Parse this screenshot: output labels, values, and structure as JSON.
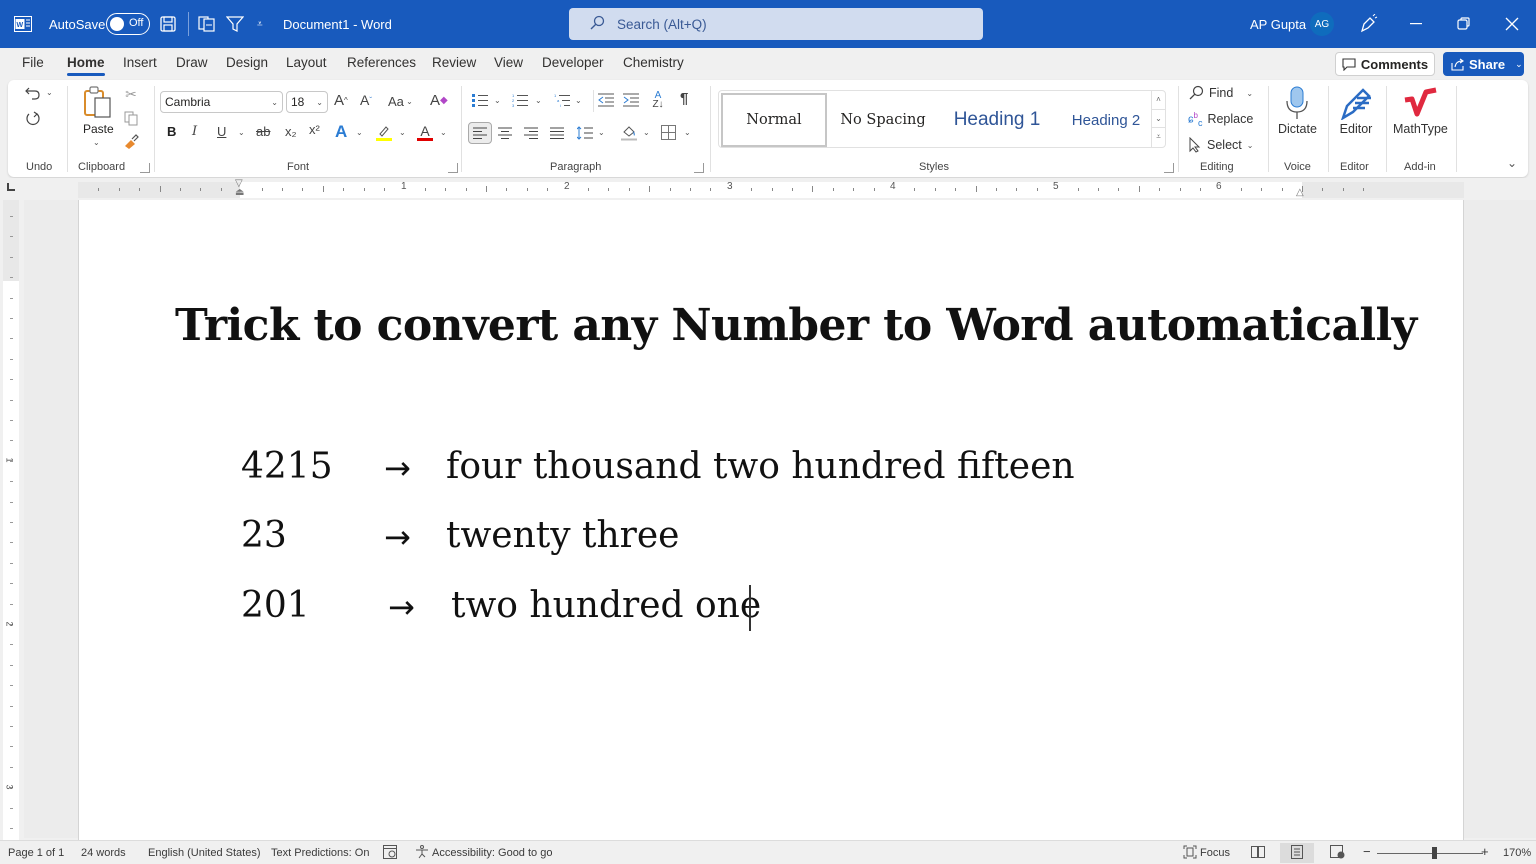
{
  "titlebar": {
    "autosave_label": "AutoSave",
    "autosave_state": "Off",
    "document_title": "Document1  -  Word",
    "search_placeholder": "Search (Alt+Q)",
    "user_name": "AP Gupta",
    "user_initials": "AG",
    "icons": [
      "word-logo-icon",
      "save-icon",
      "touch-mode-icon",
      "filter-icon",
      "customize-toolbar-icon",
      "pen-icon",
      "minimize-icon",
      "restore-icon",
      "close-icon"
    ],
    "brand_color": "#185abd"
  },
  "tabs": [
    {
      "label": "File",
      "active": false
    },
    {
      "label": "Home",
      "active": true
    },
    {
      "label": "Insert",
      "active": false
    },
    {
      "label": "Draw",
      "active": false
    },
    {
      "label": "Design",
      "active": false
    },
    {
      "label": "Layout",
      "active": false
    },
    {
      "label": "References",
      "active": false
    },
    {
      "label": "Review",
      "active": false
    },
    {
      "label": "View",
      "active": false
    },
    {
      "label": "Developer",
      "active": false
    },
    {
      "label": "Chemistry",
      "active": false
    }
  ],
  "header_buttons": {
    "comments": "Comments",
    "share": "Share"
  },
  "ribbon": {
    "groups": {
      "undo": "Undo",
      "clipboard": "Clipboard",
      "font": "Font",
      "paragraph": "Paragraph",
      "styles": "Styles",
      "editing": "Editing",
      "voice": "Voice",
      "editor": "Editor",
      "addin": "Add-in"
    },
    "paste_label": "Paste",
    "font_name": "Cambria",
    "font_size": "18",
    "font_buttons": {
      "bold": "B",
      "italic": "I",
      "underline": "U",
      "strike": "ab",
      "subscript": "x₂",
      "superscript": "x²",
      "grow": "A^",
      "shrink": "Aˇ",
      "case": "Aa"
    },
    "highlight_color": "#ffff00",
    "font_color": "#e00000",
    "styles": [
      {
        "label": "Normal",
        "selected": true
      },
      {
        "label": "No Spacing",
        "selected": false
      },
      {
        "label": "Heading 1",
        "selected": false
      },
      {
        "label": "Heading 2",
        "selected": false
      }
    ],
    "editing": {
      "find": "Find",
      "replace": "Replace",
      "select": "Select"
    },
    "dictate": "Dictate",
    "editor": "Editor",
    "mathtype": "MathType"
  },
  "ruler": {
    "h_numbers": [
      "1",
      "2",
      "3",
      "4",
      "5",
      "6"
    ],
    "v_numbers": [
      "1",
      "2",
      "3"
    ]
  },
  "document": {
    "title": "Trick to convert any Number to Word automatically",
    "rows": [
      {
        "number": "4215",
        "arrow": "→",
        "words": "four thousand two hundred fifteen"
      },
      {
        "number": "23",
        "arrow": "→",
        "words": "twenty three"
      },
      {
        "number": "201",
        "arrow": "→",
        "words": "two hundred one"
      }
    ]
  },
  "status": {
    "page": "Page 1 of 1",
    "words": "24 words",
    "language": "English (United States)",
    "predictions": "Text Predictions: On",
    "accessibility": "Accessibility: Good to go",
    "focus": "Focus",
    "zoom_level": "170%",
    "zoom_minus": "−",
    "zoom_plus": "+"
  }
}
